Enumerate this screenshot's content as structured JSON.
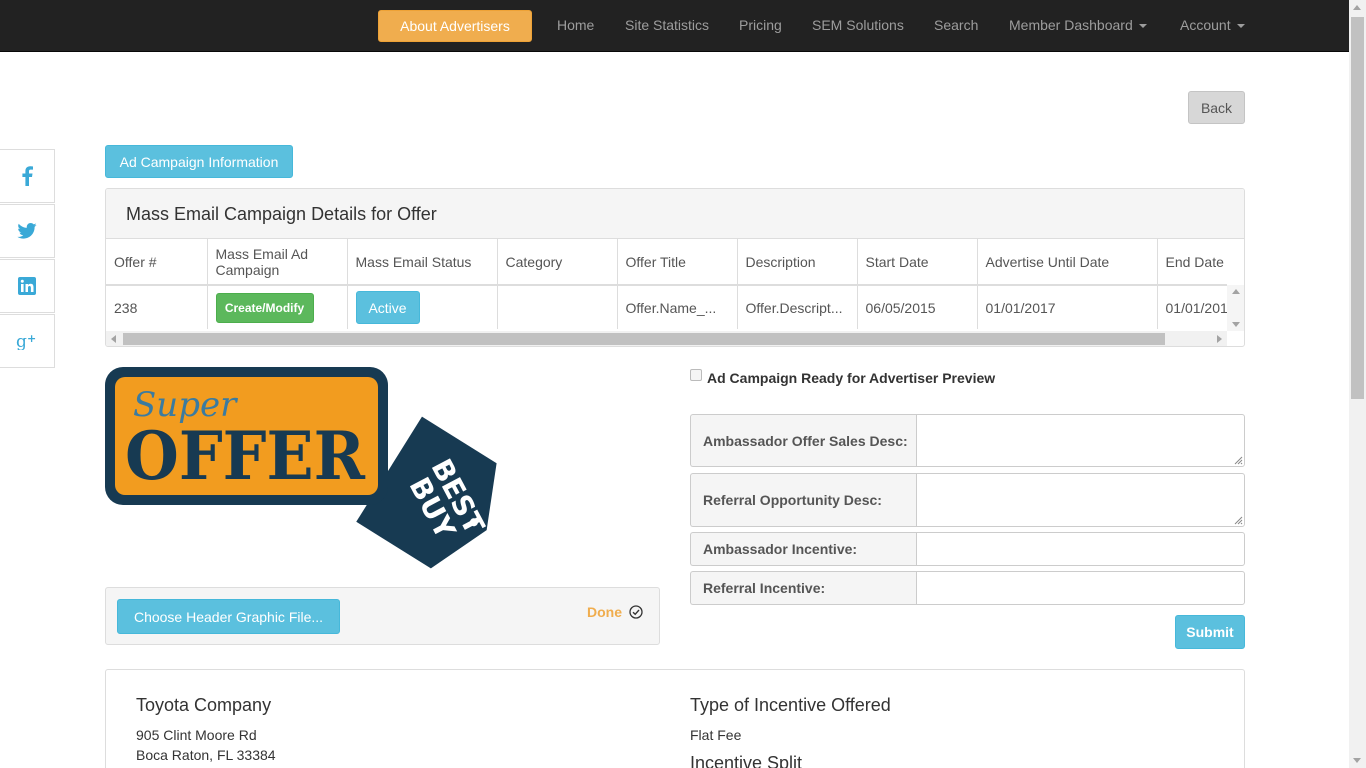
{
  "nav": {
    "about": "About Advertisers",
    "home": "Home",
    "site_statistics": "Site Statistics",
    "pricing": "Pricing",
    "sem": "SEM Solutions",
    "search": "Search",
    "member_dashboard": "Member Dashboard",
    "account": "Account"
  },
  "back_label": "Back",
  "tab_label": "Ad Campaign Information",
  "panel_title": "Mass Email Campaign Details for Offer",
  "table": {
    "headers": [
      "Offer #",
      "Mass Email Ad Campaign",
      "Mass Email Status",
      "Category",
      "Offer Title",
      "Description",
      "Start Date",
      "Advertise Until Date",
      "End Date"
    ],
    "row": {
      "offer_no": "238",
      "campaign_button": "Create/Modify",
      "status_button": "Active",
      "category": "",
      "offer_title": "Offer.Name_...",
      "description": "Offer.Descript...",
      "start_date": "06/05/2015",
      "advertise_until": "01/01/2017",
      "end_date": "01/01/201"
    }
  },
  "graphic": {
    "text_super": "Super",
    "text_offer": "OFFER",
    "text_best": "BEST",
    "text_buy": "BUY",
    "colors": {
      "orange": "#f29c1f",
      "navy": "#173a52",
      "teal": "#3b7ba0"
    }
  },
  "upload": {
    "choose_label": "Choose Header Graphic File...",
    "done_label": "Done"
  },
  "form": {
    "preview_checkbox_label": "Ad Campaign Ready for Advertiser Preview",
    "preview_checked": false,
    "ambassador_offer_label": "Ambassador Offer Sales Desc:",
    "ambassador_offer_value": "",
    "referral_opp_label": "Referral Opportunity Desc:",
    "referral_opp_value": "",
    "ambassador_incentive_label": "Ambassador Incentive:",
    "ambassador_incentive_value": "",
    "referral_incentive_label": "Referral Incentive:",
    "referral_incentive_value": "",
    "submit_label": "Submit"
  },
  "company": {
    "name": "Toyota Company",
    "address_line1": "905 Clint Moore Rd",
    "address_line2": "Boca Raton, FL 33384",
    "incentive_type_title": "Type of Incentive Offered",
    "incentive_type_value": "Flat Fee",
    "incentive_split_title": "Incentive Split"
  },
  "social_icons": [
    "facebook-icon",
    "twitter-icon",
    "linkedin-icon",
    "google-plus-icon"
  ],
  "colors": {
    "navbar": "#222222",
    "warning": "#f0ad4e",
    "info": "#5bc0de",
    "success": "#5cb85c",
    "social": "#3aa9d7"
  }
}
